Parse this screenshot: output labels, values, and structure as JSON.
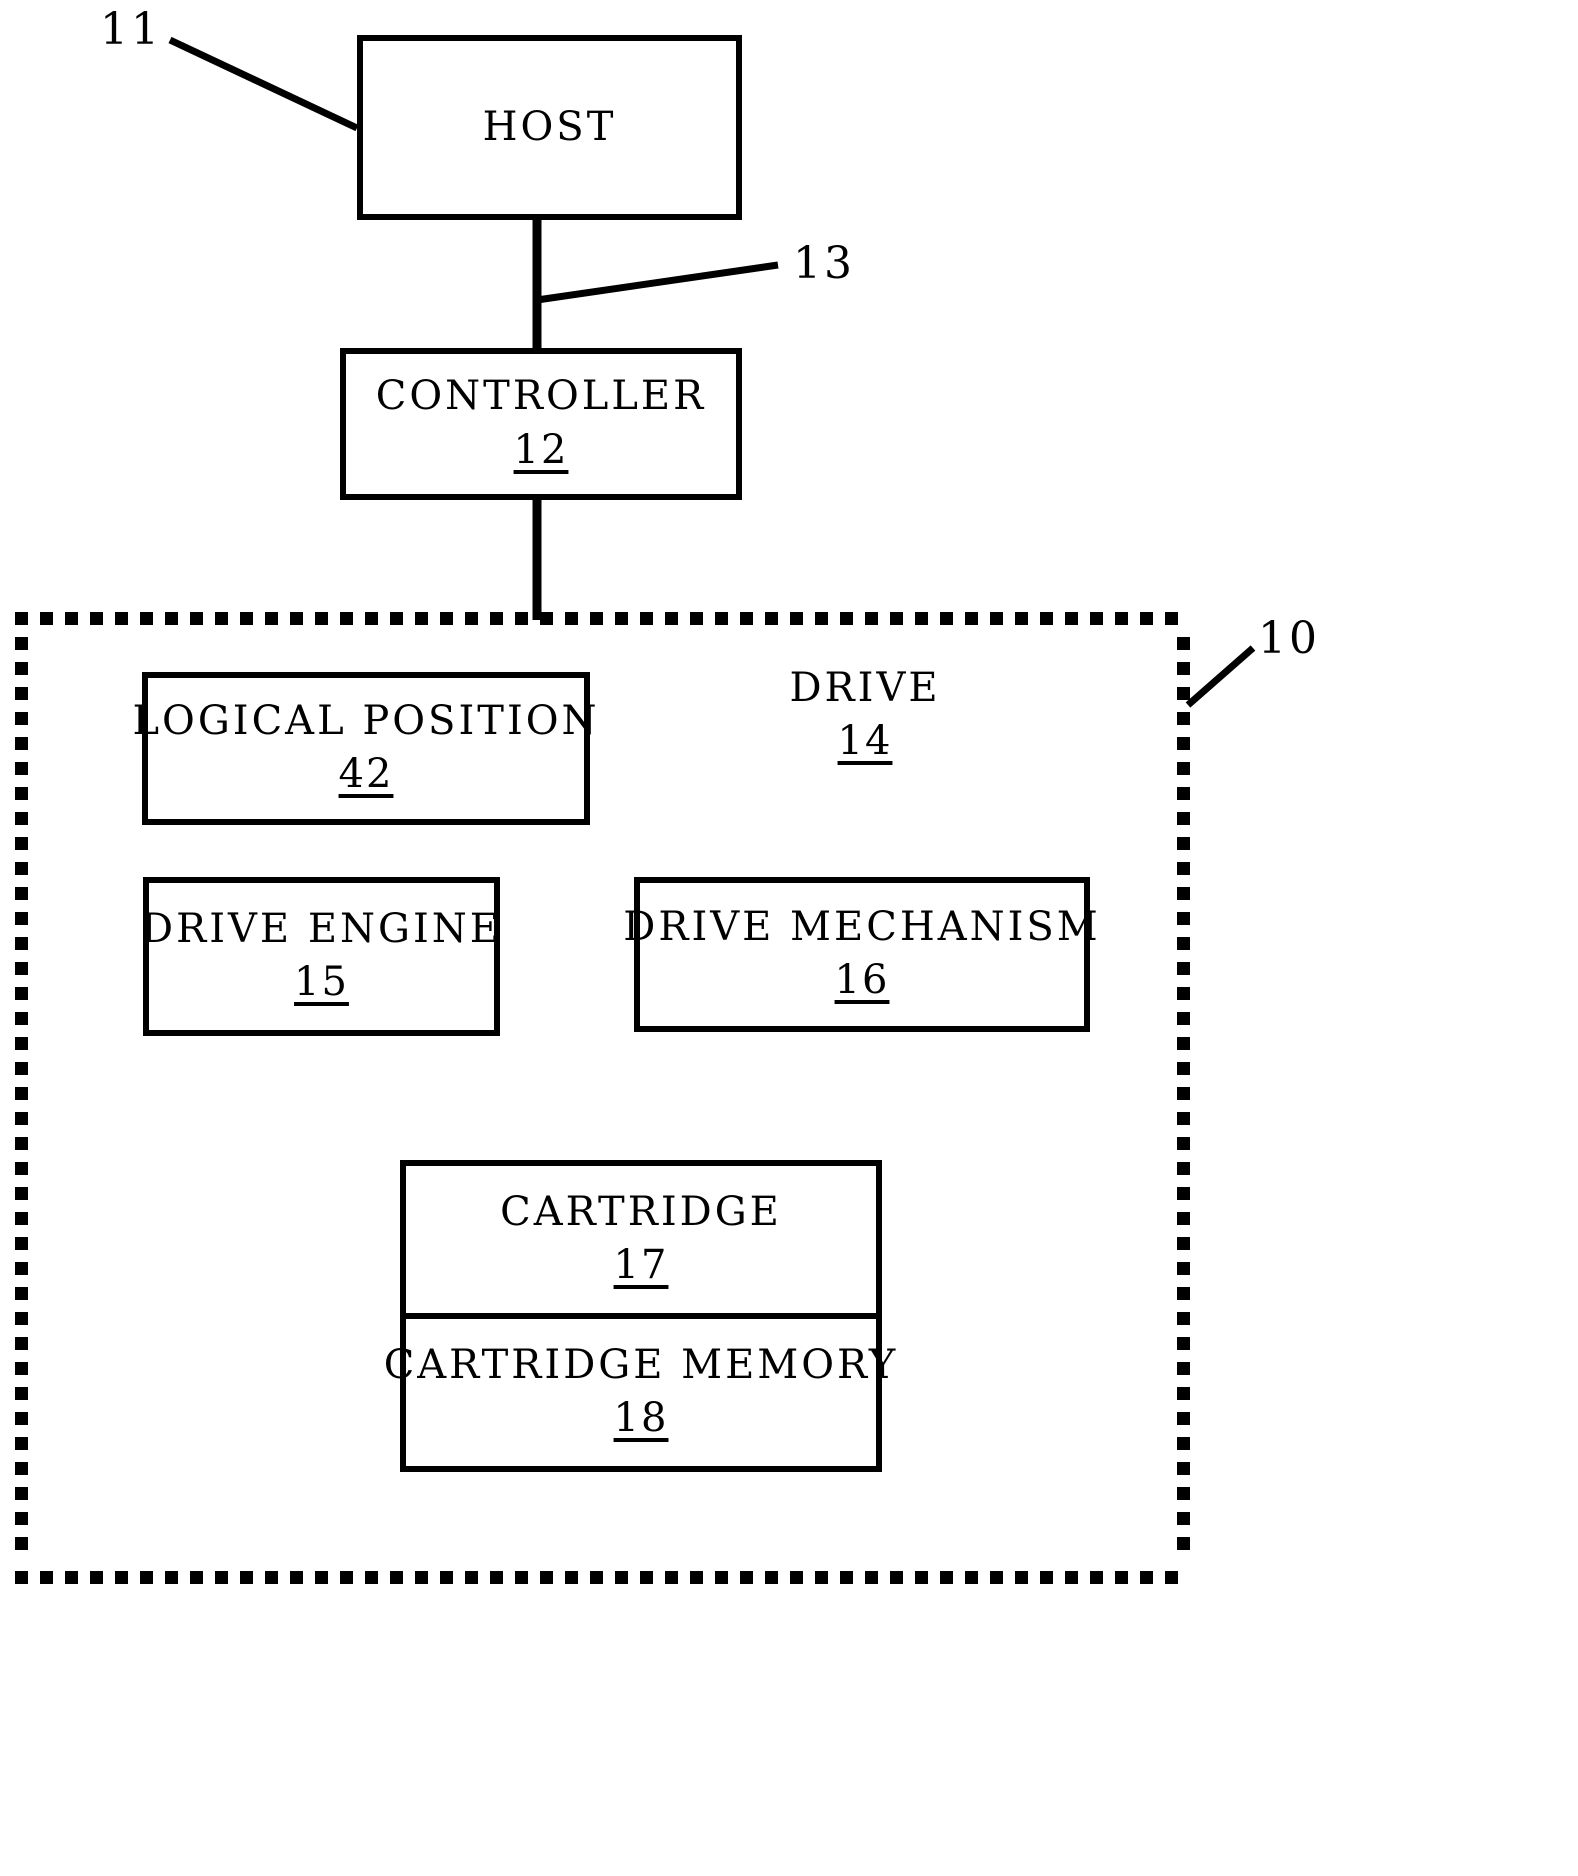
{
  "figure": {
    "type": "patent-block-diagram",
    "background_color": "#ffffff",
    "line_color": "#000000"
  },
  "callouts": [
    {
      "id": "callout-11",
      "text": "11"
    },
    {
      "id": "callout-13",
      "text": "13"
    },
    {
      "id": "callout-10",
      "text": "10"
    }
  ],
  "blocks": {
    "host": {
      "label": "HOST",
      "ref": ""
    },
    "controller": {
      "label": "CONTROLLER",
      "ref": "12"
    },
    "drive": {
      "label": "DRIVE",
      "ref": "14"
    },
    "logical_position": {
      "label": "LOGICAL POSITION",
      "ref": "42"
    },
    "drive_engine": {
      "label": "DRIVE ENGINE",
      "ref": "15"
    },
    "drive_mechanism": {
      "label": "DRIVE MECHANISM",
      "ref": "16"
    },
    "cartridge": {
      "label": "CARTRIDGE",
      "ref": "17"
    },
    "cartridge_memory": {
      "label": "CARTRIDGE MEMORY",
      "ref": "18"
    }
  }
}
